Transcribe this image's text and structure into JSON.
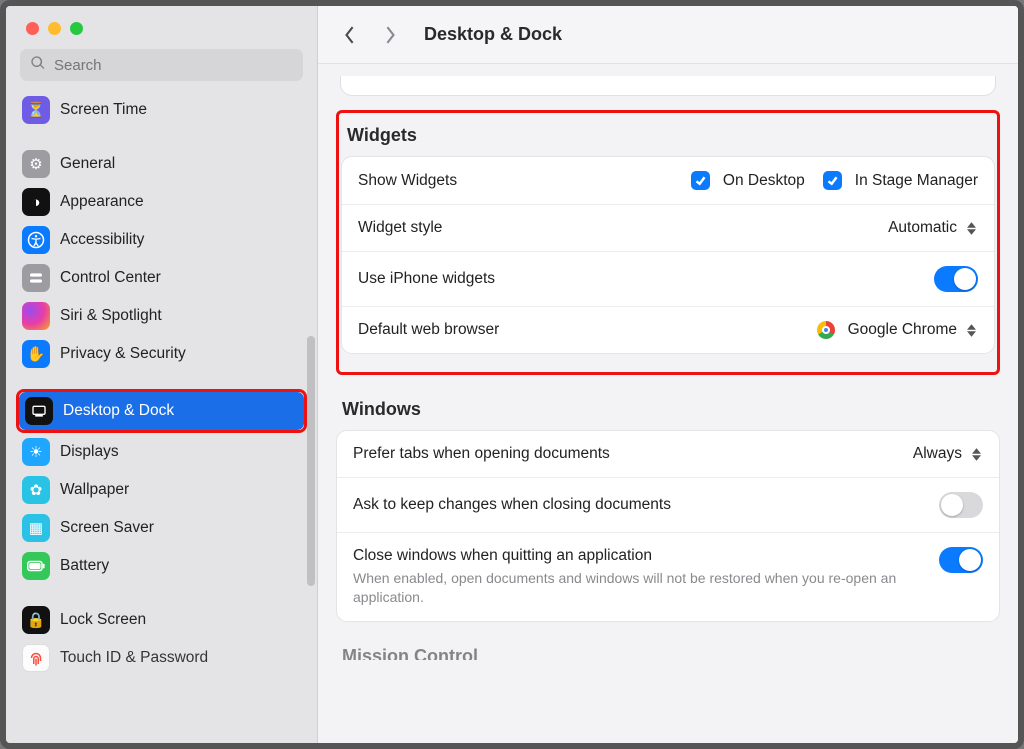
{
  "search": {
    "placeholder": "Search"
  },
  "header": {
    "title": "Desktop & Dock"
  },
  "sidebar": {
    "items": [
      {
        "label": "Screen Time"
      },
      {
        "label": "General"
      },
      {
        "label": "Appearance"
      },
      {
        "label": "Accessibility"
      },
      {
        "label": "Control Center"
      },
      {
        "label": "Siri & Spotlight"
      },
      {
        "label": "Privacy & Security"
      },
      {
        "label": "Desktop & Dock"
      },
      {
        "label": "Displays"
      },
      {
        "label": "Wallpaper"
      },
      {
        "label": "Screen Saver"
      },
      {
        "label": "Battery"
      },
      {
        "label": "Lock Screen"
      },
      {
        "label": "Touch ID & Password"
      }
    ]
  },
  "widgets": {
    "section": "Widgets",
    "show_label": "Show Widgets",
    "on_desktop": "On Desktop",
    "in_stage_manager": "In Stage Manager",
    "style_label": "Widget style",
    "style_value": "Automatic",
    "iphone_label": "Use iPhone widgets",
    "browser_label": "Default web browser",
    "browser_value": "Google Chrome"
  },
  "windows": {
    "section": "Windows",
    "tabs_label": "Prefer tabs when opening documents",
    "tabs_value": "Always",
    "ask_label": "Ask to keep changes when closing documents",
    "close_label": "Close windows when quitting an application",
    "close_sub": "When enabled, open documents and windows will not be restored when you re-open an application."
  },
  "mission": {
    "section": "Mission Control"
  }
}
